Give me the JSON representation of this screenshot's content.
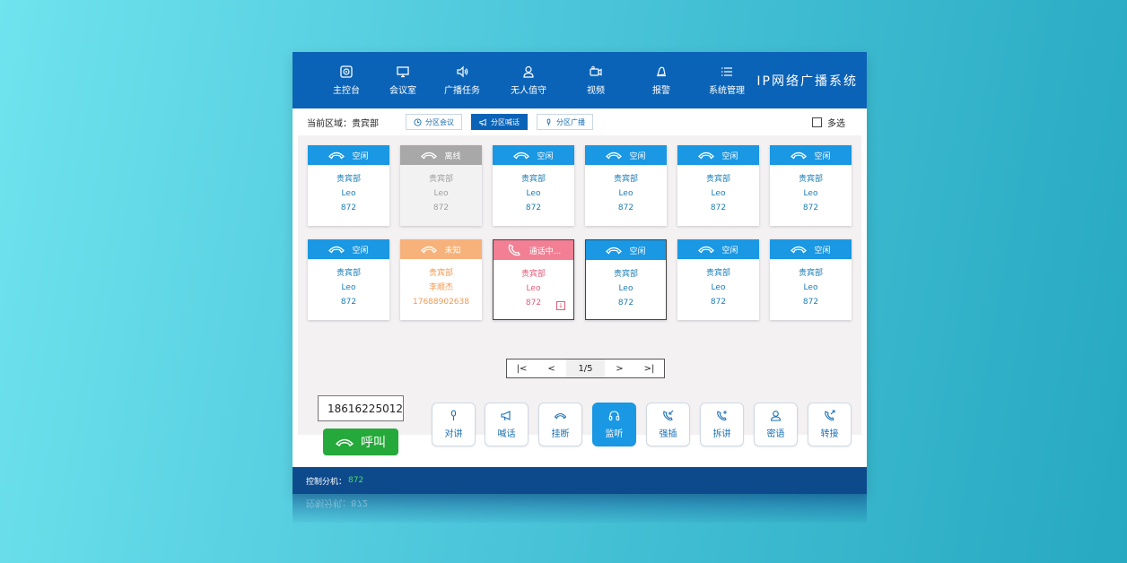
{
  "header": {
    "nav": [
      {
        "label": "主控台",
        "icon": "console-icon"
      },
      {
        "label": "会议室",
        "icon": "monitor-icon"
      },
      {
        "label": "广播任务",
        "icon": "speaker-icon"
      },
      {
        "label": "无人值守",
        "icon": "user-icon"
      },
      {
        "label": "视频",
        "icon": "camera-icon"
      },
      {
        "label": "报警",
        "icon": "alarm-icon"
      },
      {
        "label": "系统管理",
        "icon": "list-icon"
      }
    ],
    "system_title": "IP网络广播系统"
  },
  "area": {
    "current_label": "当前区域：贵宾部",
    "buttons": [
      {
        "label": "分区会议",
        "icon": "clock-icon"
      },
      {
        "label": "分区喊话",
        "icon": "megaphone-icon"
      },
      {
        "label": "分区广播",
        "icon": "mic-icon"
      }
    ],
    "multi_select_label": "多选"
  },
  "cards": [
    {
      "status": "空闲",
      "state": "idle",
      "dept": "贵宾部",
      "name": "Leo",
      "ext": "872"
    },
    {
      "status": "离线",
      "state": "offline",
      "dept": "贵宾部",
      "name": "Leo",
      "ext": "872"
    },
    {
      "status": "空闲",
      "state": "idle",
      "dept": "贵宾部",
      "name": "Leo",
      "ext": "872"
    },
    {
      "status": "空闲",
      "state": "idle",
      "dept": "贵宾部",
      "name": "Leo",
      "ext": "872"
    },
    {
      "status": "空闲",
      "state": "idle",
      "dept": "贵宾部",
      "name": "Leo",
      "ext": "872"
    },
    {
      "status": "空闲",
      "state": "idle",
      "dept": "贵宾部",
      "name": "Leo",
      "ext": "872"
    },
    {
      "status": "空闲",
      "state": "idle",
      "dept": "贵宾部",
      "name": "Leo",
      "ext": "872"
    },
    {
      "status": "未知",
      "state": "unknown",
      "dept": "贵宾部",
      "name": "李顺杰",
      "ext": "17688902638"
    },
    {
      "status": "通话中...",
      "state": "calling",
      "dept": "贵宾部",
      "name": "Leo",
      "ext": "872"
    },
    {
      "status": "空闲",
      "state": "selected",
      "dept": "贵宾部",
      "name": "Leo",
      "ext": "872"
    },
    {
      "status": "空闲",
      "state": "idle",
      "dept": "贵宾部",
      "name": "Leo",
      "ext": "872"
    },
    {
      "status": "空闲",
      "state": "idle",
      "dept": "贵宾部",
      "name": "Leo",
      "ext": "872"
    }
  ],
  "pager": {
    "first": "|<",
    "prev": "<",
    "page": "1/5",
    "next": ">",
    "last": ">|"
  },
  "dial": {
    "number": "18616225012",
    "call_label": "呼叫"
  },
  "controls": [
    {
      "label": "对讲",
      "icon": "mic-icon"
    },
    {
      "label": "喊话",
      "icon": "megaphone-icon"
    },
    {
      "label": "挂断",
      "icon": "hangup-icon"
    },
    {
      "label": "监听",
      "icon": "headset-icon",
      "active": true
    },
    {
      "label": "强插",
      "icon": "phone-incoming-icon"
    },
    {
      "label": "拆讲",
      "icon": "phone-plus-icon"
    },
    {
      "label": "密语",
      "icon": "user-headset-icon"
    },
    {
      "label": "转接",
      "icon": "phone-forward-icon"
    }
  ],
  "footer": {
    "label": "控制分机：",
    "ext": "872"
  },
  "colors": {
    "header": "#0b63b7",
    "idle": "#1a98e3",
    "offline": "#a8a8a8",
    "unknown": "#f7b27b",
    "calling": "#f37f94",
    "call_button": "#25a93a",
    "footer": "#0d4a8c"
  }
}
